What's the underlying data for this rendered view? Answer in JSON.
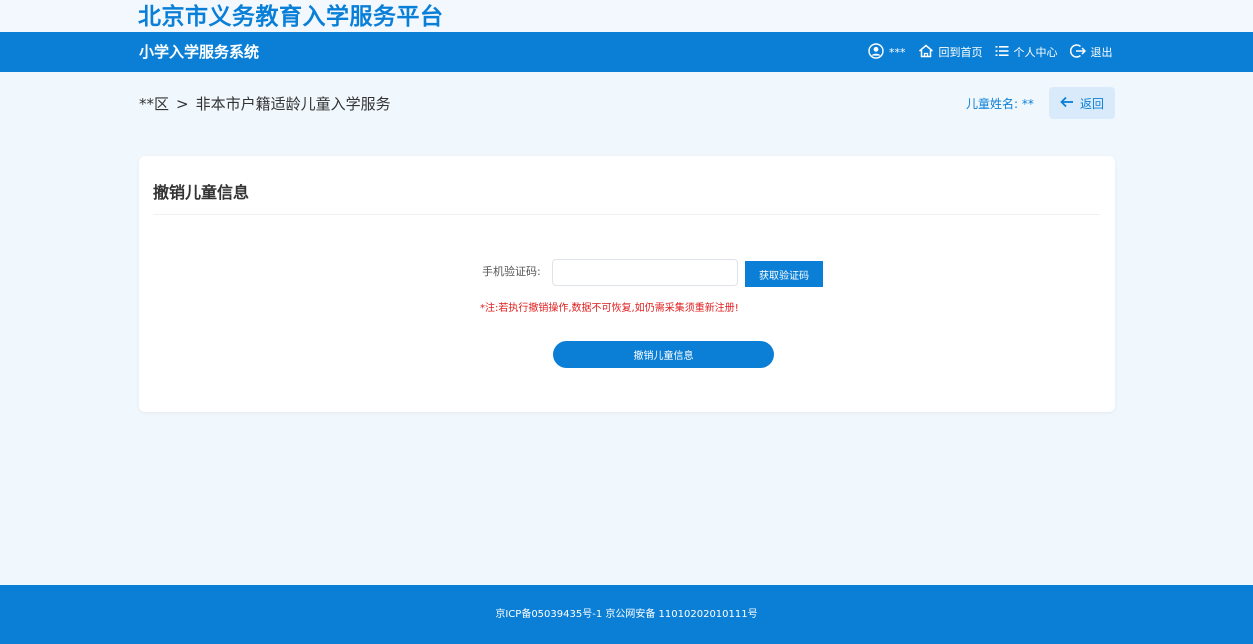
{
  "header": {
    "site_title": "北京市义务教育入学服务平台",
    "system_name": "小学入学服务系统",
    "user_name": "***",
    "nav": {
      "home_label": "回到首页",
      "personal_center_label": "个人中心",
      "logout_label": "退出"
    }
  },
  "breadcrumb": {
    "district": "**区",
    "separator": ">",
    "service": "非本市户籍适龄儿童入学服务"
  },
  "child": {
    "name_label": "儿童姓名:",
    "name_value": "**"
  },
  "back_label": "返回",
  "card": {
    "title": "撤销儿童信息",
    "phone_code_label": "手机验证码:",
    "phone_code_value": "",
    "phone_code_placeholder": "",
    "get_code_label": "获取验证码",
    "warning": "*注:若执行撤销操作,数据不可恢复,如仍需采集须重新注册!",
    "submit_label": "撤销儿童信息"
  },
  "footer": {
    "text": "京ICP备05039435号-1 京公网安备 11010202010111号"
  },
  "colors": {
    "primary": "#0b7fd6",
    "background": "#f0f7fd",
    "warning": "#e02020"
  },
  "icons": [
    "user-avatar-icon",
    "home-icon",
    "list-icon",
    "logout-icon",
    "arrow-left-icon"
  ]
}
